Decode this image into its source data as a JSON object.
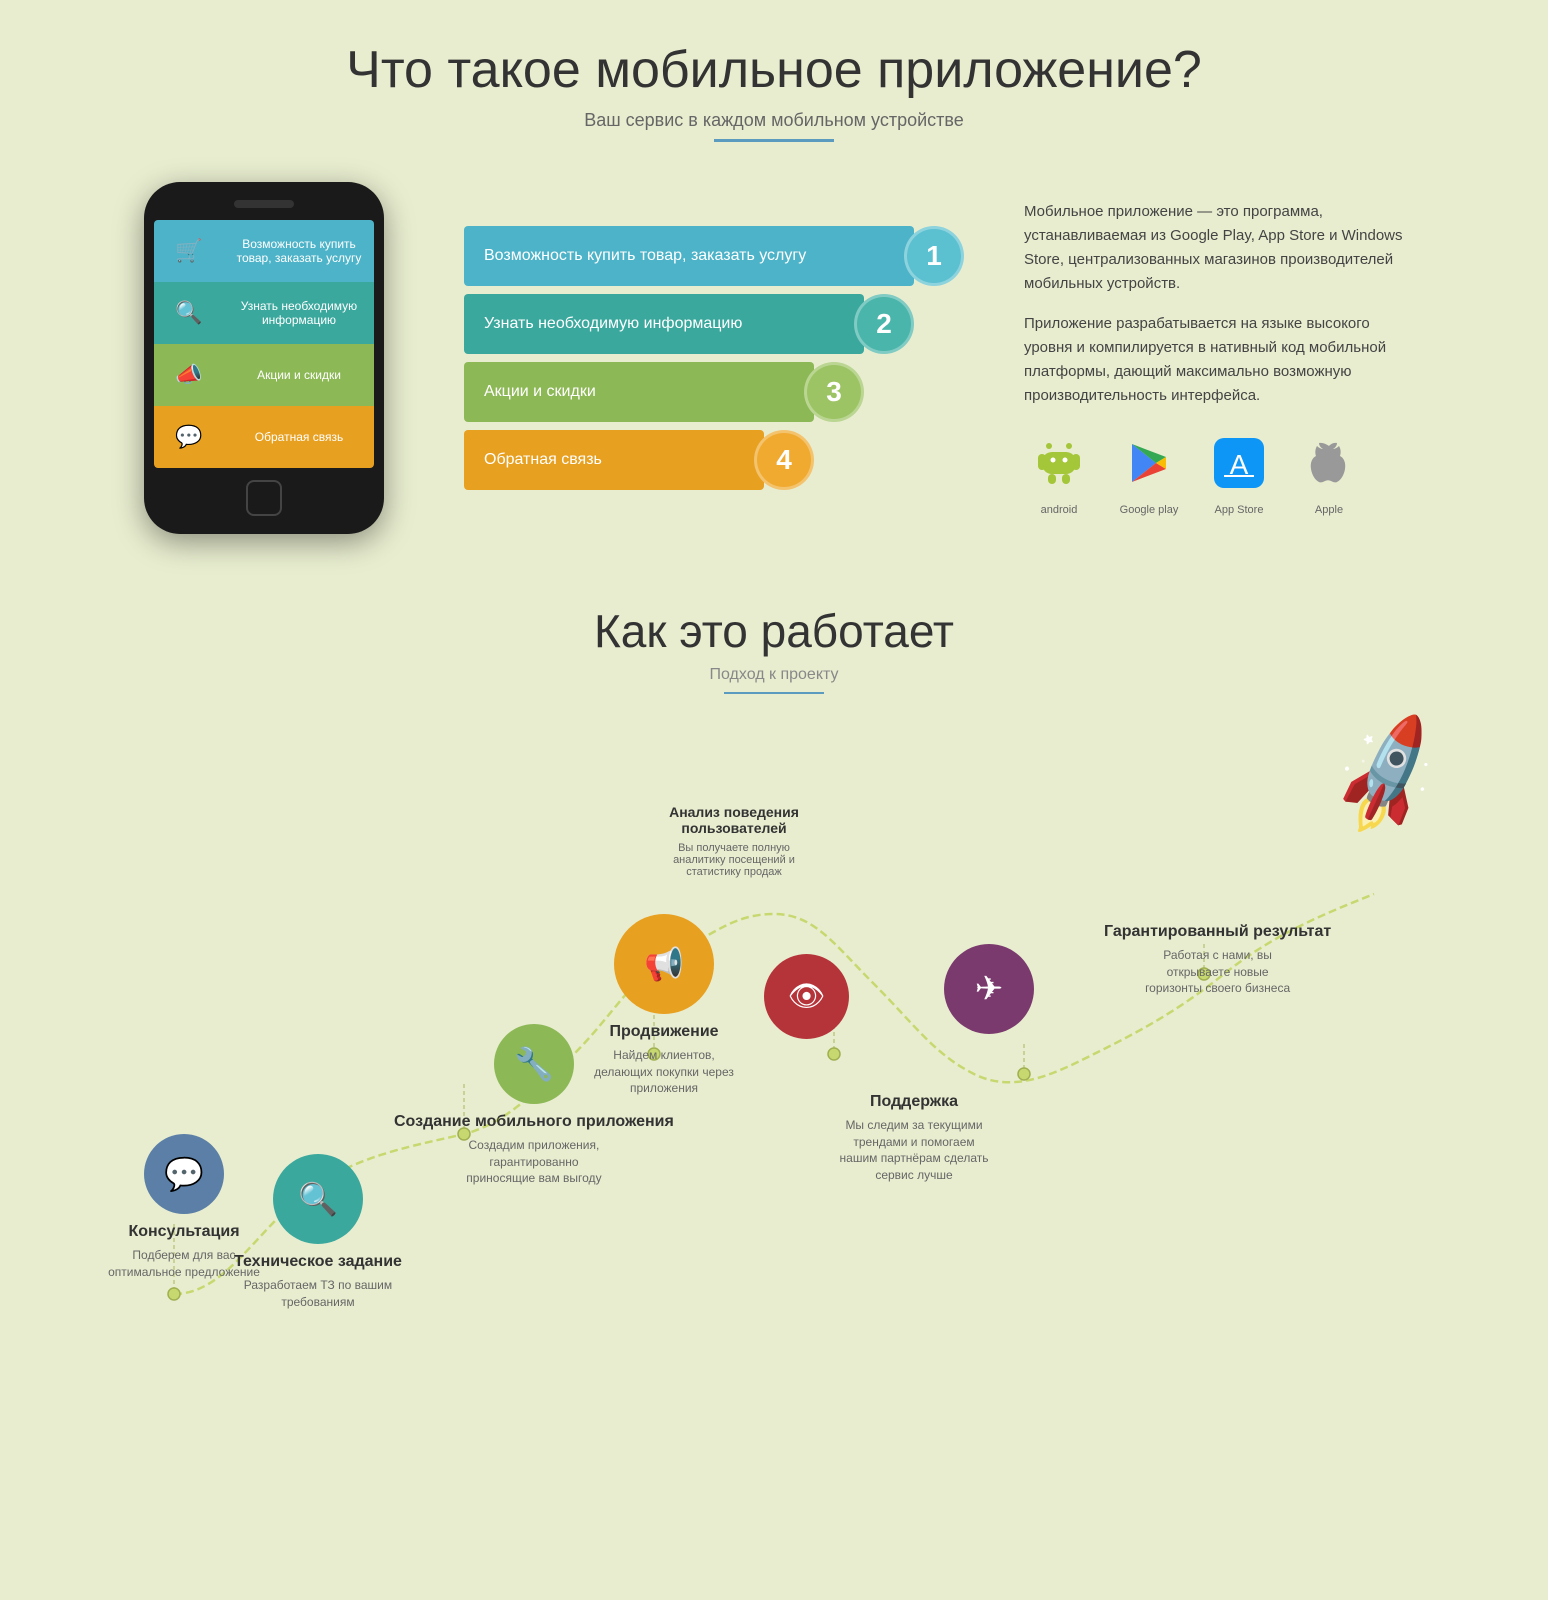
{
  "page": {
    "section1": {
      "title": "Что такое мобильное приложение?",
      "subtitle": "Ваш сервис в каждом мобильном устройстве",
      "features": [
        {
          "label": "Возможность купить товар, заказать услугу",
          "number": "1"
        },
        {
          "label": "Узнать необходимую информацию",
          "number": "2"
        },
        {
          "label": "Акции и скидки",
          "number": "3"
        },
        {
          "label": "Обратная связь",
          "number": "4"
        }
      ],
      "description1": "Мобильное приложение — это программа, устанавливаемая из Google Play, App Store и Windows Store, централизованных магазинов производителей мобильных устройств.",
      "description2": "Приложение разрабатывается на языке высокого уровня и компилируется в нативный код мобильной платформы, дающий максимально возможную производительность интерфейса.",
      "stores": [
        {
          "label": "Android",
          "icon": "🤖"
        },
        {
          "label": "Google play",
          "icon": "▶"
        },
        {
          "label": "App Store",
          "icon": "🅐"
        },
        {
          "label": "Apple",
          "icon": "🍎"
        }
      ]
    },
    "section2": {
      "title": "Как это работает",
      "subtitle": "Подход к проекту",
      "nodes": [
        {
          "id": "konsult",
          "title": "Консультация",
          "desc": "Подберем для вас оптимальное предложение",
          "icon": "💬"
        },
        {
          "id": "search",
          "title": "Техническое задание",
          "desc": "Разработаем ТЗ по вашим требованиям",
          "icon": "🔍"
        },
        {
          "id": "tools",
          "title": "Создание мобильного приложения",
          "desc": "Создадим приложения, гарантированно приносящие вам выгоду",
          "icon": "🔧"
        },
        {
          "id": "promo",
          "title": "Продвижение",
          "desc": "Найдем клиентов, делающих покупки через приложения",
          "icon": "📢"
        },
        {
          "id": "analytics",
          "title": "Анализ поведения пользователей",
          "desc": "Вы получаете полную аналитику посещений и статистику продаж",
          "icon": "👁"
        },
        {
          "id": "support",
          "title": "Поддержка",
          "desc": "Мы следим за текущими трендами и помогаем нашим партнёрам сделать сервис лучше",
          "icon": "✈"
        },
        {
          "id": "result",
          "title": "Гарантированный результат",
          "desc": "Работая с нами, вы открываете новые горизонты своего бизнеса",
          "icon": "🚀"
        }
      ]
    }
  }
}
